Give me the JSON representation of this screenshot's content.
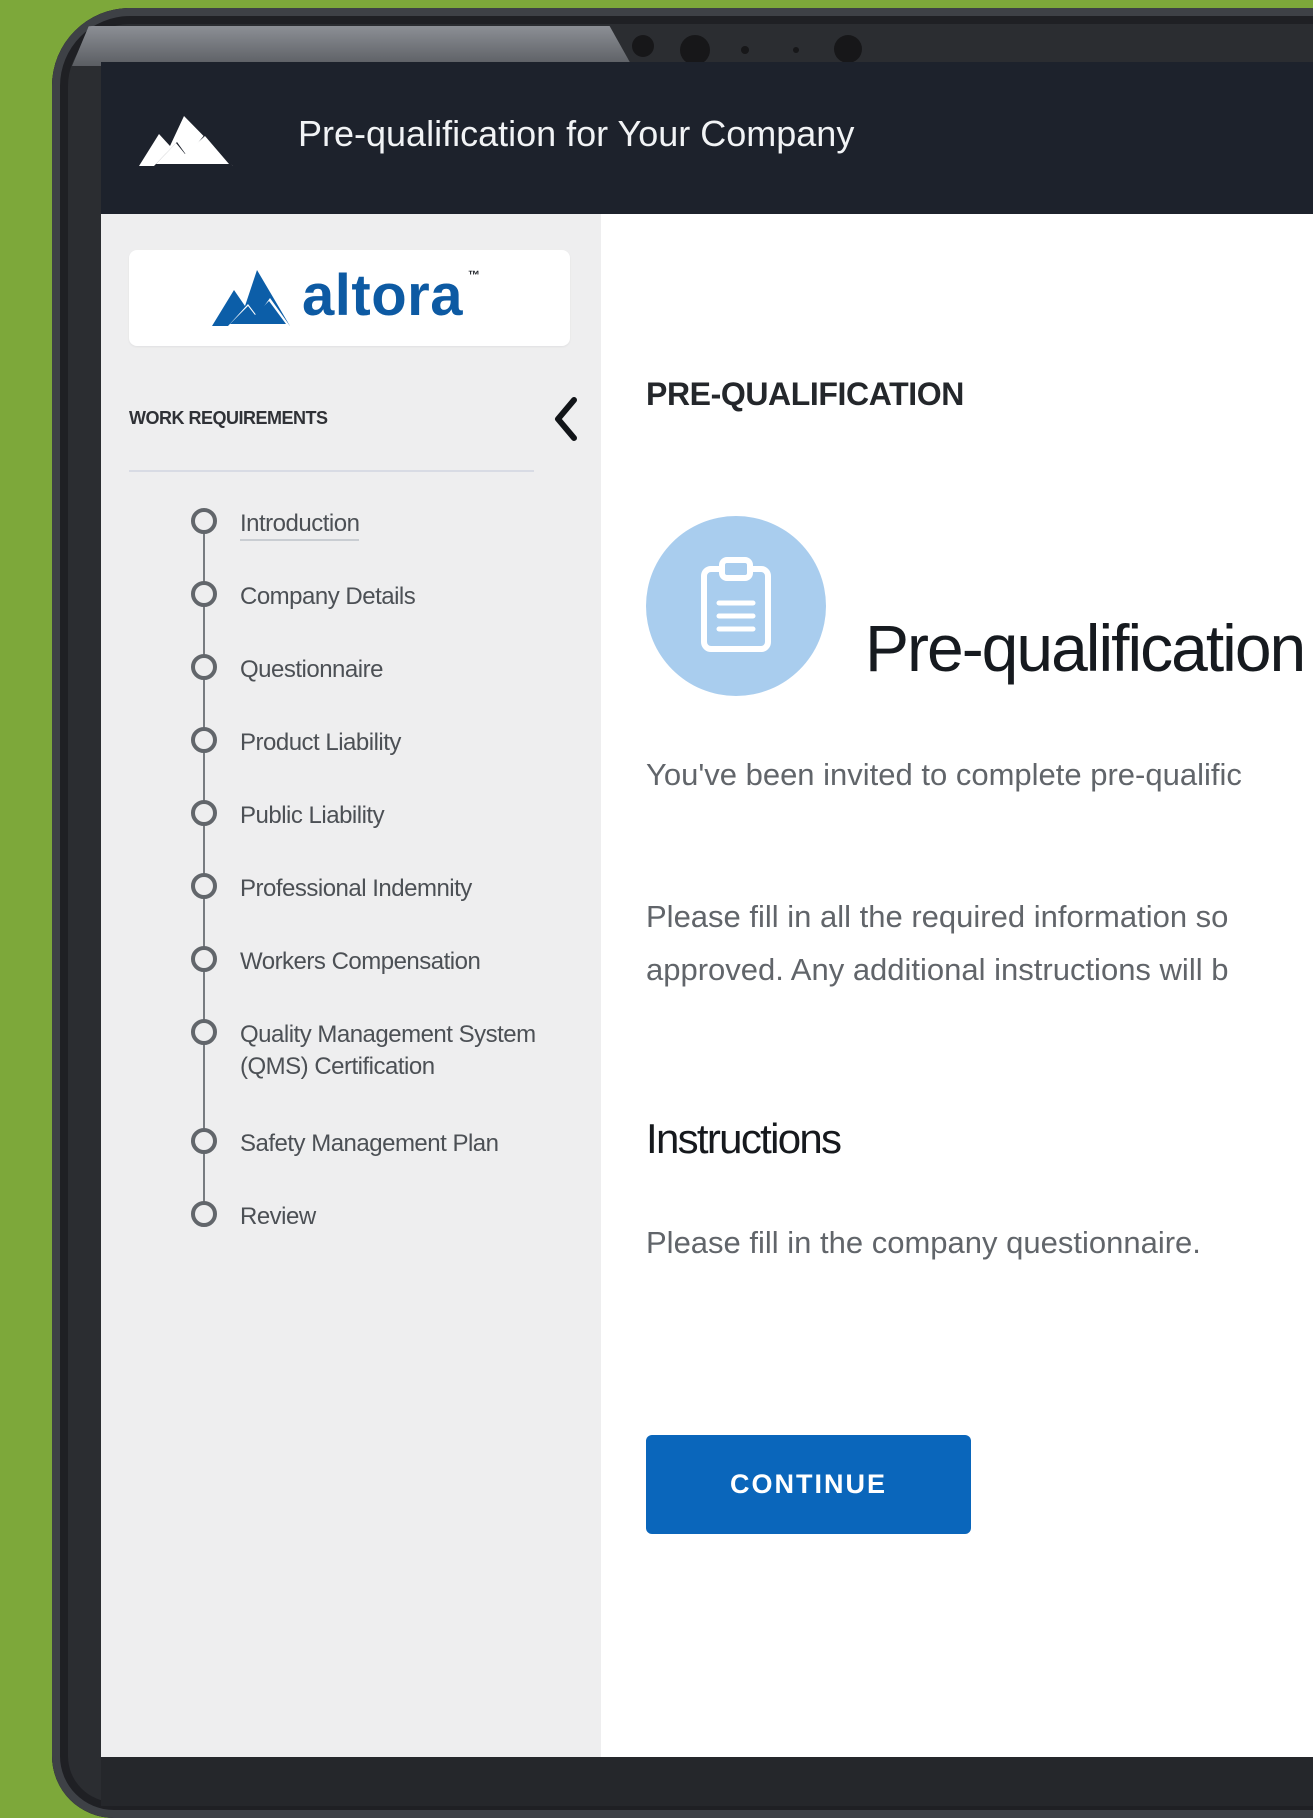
{
  "app": {
    "title": "Pre-qualification for Your Company"
  },
  "brand": {
    "name": "altora",
    "tm": "™"
  },
  "sidebar": {
    "section_label": "WORK REQUIREMENTS",
    "steps": [
      {
        "label": "Introduction"
      },
      {
        "label": "Company Details"
      },
      {
        "label": "Questionnaire"
      },
      {
        "label": "Product Liability"
      },
      {
        "label": "Public Liability"
      },
      {
        "label": "Professional Indemnity"
      },
      {
        "label": "Workers Compensation"
      },
      {
        "label": "Quality Management System (QMS) Certification"
      },
      {
        "label": "Safety Management Plan"
      },
      {
        "label": "Review"
      }
    ]
  },
  "main": {
    "eyebrow": "PRE-QUALIFICATION",
    "title": "Pre-qualification",
    "intro": "You've been invited to complete pre-qualific",
    "fill_line_1": "Please fill in all the required information so",
    "fill_line_2": "approved. Any additional instructions will b",
    "instructions_heading": "Instructions",
    "instructions_text": "Please fill in the company questionnaire.",
    "continue_label": "CONTINUE"
  },
  "colors": {
    "background": "#7da83a",
    "topbar": "#1d222c",
    "sidebar": "#eeeeef",
    "accent": "#0a66bb",
    "hero_icon": "#a9cdee"
  },
  "icons": {
    "topbar_logo": "mountain-logo-icon",
    "collapse": "chevron-left-icon",
    "hero": "clipboard-icon"
  }
}
